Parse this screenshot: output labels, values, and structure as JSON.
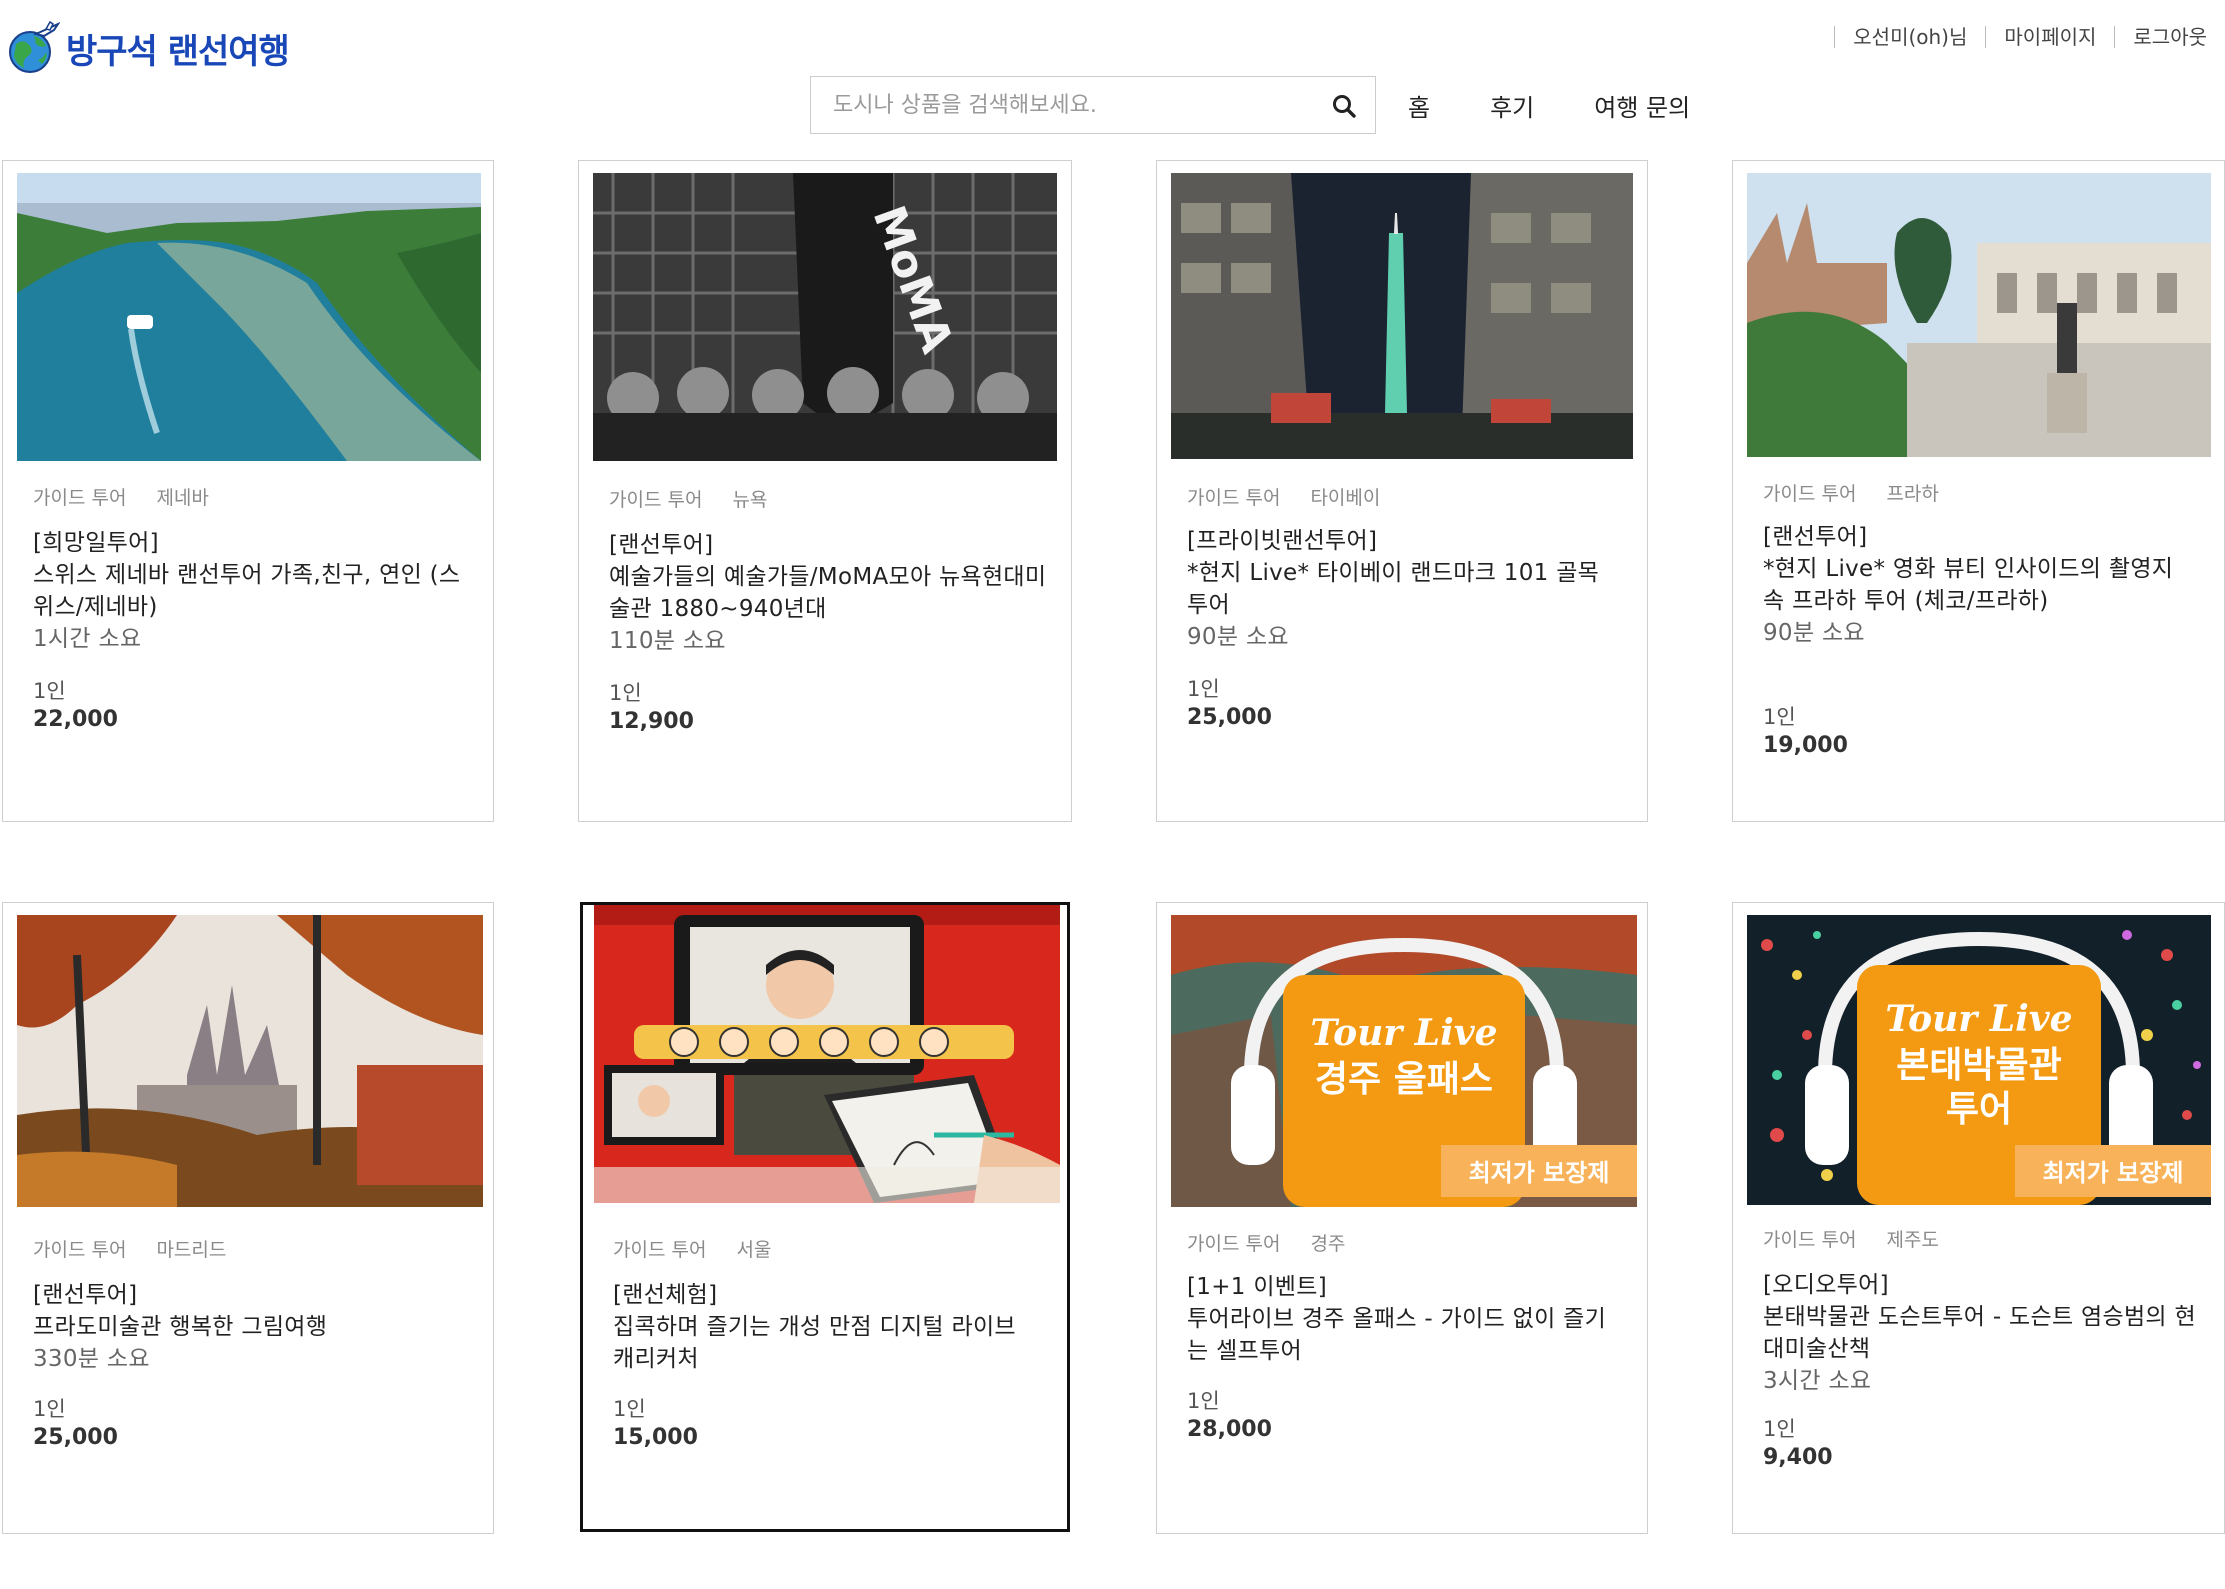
{
  "header": {
    "logo_text": "방구석 랜선여행",
    "user_links": [
      "오선미(oh)님",
      "마이페이지",
      "로그아웃"
    ],
    "search_placeholder": "도시나 상품을 검색해보세요.",
    "nav": [
      "홈",
      "후기",
      "여행 문의"
    ]
  },
  "products": [
    {
      "category": "가이드 투어",
      "city": "제네바",
      "tag": "[희망일투어]",
      "title": "스위스 제네바 랜선투어 가족,친구, 연인 (스위스/제네바)",
      "duration": "1시간 소요",
      "pax": "1인",
      "price": "22,000",
      "image": "river-photo"
    },
    {
      "category": "가이드 투어",
      "city": "뉴욕",
      "tag": "[랜선투어]",
      "title": "예술가들의 예술가들/MoMA모아 뉴욕현대미술관 1880~940년대",
      "duration": "110분 소요",
      "pax": "1인",
      "price": "12,900",
      "image": "moma-photo",
      "moma_text": "MoMA"
    },
    {
      "category": "가이드 투어",
      "city": "타이베이",
      "tag": "[프라이빗랜선투어]",
      "title": "*현지 Live* 타이베이 랜드마크 101 골목 투어",
      "duration": "90분 소요",
      "pax": "1인",
      "price": "25,000",
      "image": "taipei-101-photo"
    },
    {
      "category": "가이드 투어",
      "city": "프라하",
      "tag": "[랜선투어]",
      "title": "*현지 Live* 영화 뷰티 인사이드의 촬영지 속 프라하 투어 (체코/프라하)",
      "duration": "90분 소요",
      "pax": "1인",
      "price": "19,000",
      "image": "prague-square-photo"
    },
    {
      "category": "가이드 투어",
      "city": "마드리드",
      "tag": "[랜선투어]",
      "title": "프라도미술관 행복한 그림여행",
      "duration": "330분 소요",
      "pax": "1인",
      "price": "25,000",
      "image": "autumn-castle-photo"
    },
    {
      "category": "가이드 투어",
      "city": "서울",
      "tag": "[랜선체험]",
      "title": "집콕하며 즐기는 개성 만점 디지털 라이브 캐리커처",
      "duration": "",
      "pax": "1인",
      "price": "15,000",
      "image": "caricature-photo"
    },
    {
      "category": "가이드 투어",
      "city": "경주",
      "tag": "[1+1 이벤트]",
      "title": "투어라이브 경주 올패스 - 가이드 없이 즐기는 셀프투어",
      "duration": "",
      "pax": "1인",
      "price": "28,000",
      "image": "tourlive-gyeongju-banner",
      "banner_brand": "Tour Live",
      "banner_title_lines": [
        "경주 올패스"
      ],
      "banner_badge": "최저가 보장제"
    },
    {
      "category": "가이드 투어",
      "city": "제주도",
      "tag": "[오디오투어]",
      "title": "본태박물관 도슨트투어 - 도슨트 염승범의 현대미술산책",
      "duration": "3시간 소요",
      "pax": "1인",
      "price": "9,400",
      "image": "tourlive-bonte-banner",
      "banner_brand": "Tour Live",
      "banner_title_lines": [
        "본태박물관",
        "투어"
      ],
      "banner_badge": "최저가 보장제"
    }
  ]
}
